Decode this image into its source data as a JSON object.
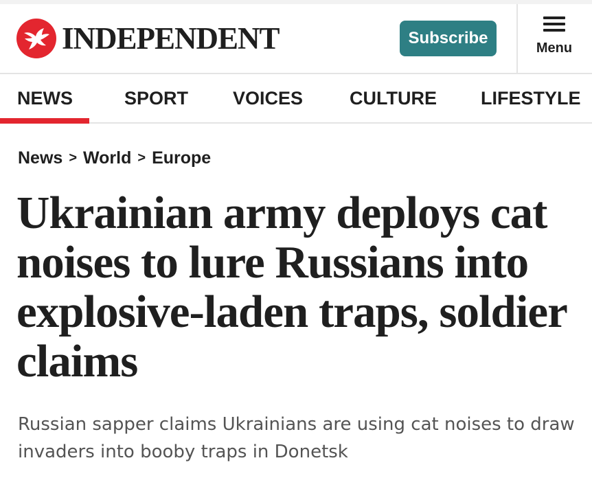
{
  "header": {
    "brand": "INDEPENDENT",
    "subscribe_label": "Subscribe",
    "menu_label": "Menu",
    "brand_color": "#e3262f",
    "subscribe_color": "#2e7f84"
  },
  "nav": {
    "items": [
      {
        "label": "NEWS",
        "active": true
      },
      {
        "label": "SPORT",
        "active": false
      },
      {
        "label": "VOICES",
        "active": false
      },
      {
        "label": "CULTURE",
        "active": false
      },
      {
        "label": "LIFESTYLE",
        "active": false
      }
    ]
  },
  "breadcrumb": {
    "items": [
      "News",
      "World",
      "Europe"
    ],
    "separator": ">"
  },
  "article": {
    "headline": "Ukrainian army deploys cat noises to lure Russians into explosive-laden traps, soldier claims",
    "standfirst": "Russian sapper claims Ukrainians are using cat noises to draw invaders into booby traps in Donetsk"
  },
  "icons": {
    "logo": "eagle-logo-icon",
    "menu": "hamburger-menu-icon"
  }
}
